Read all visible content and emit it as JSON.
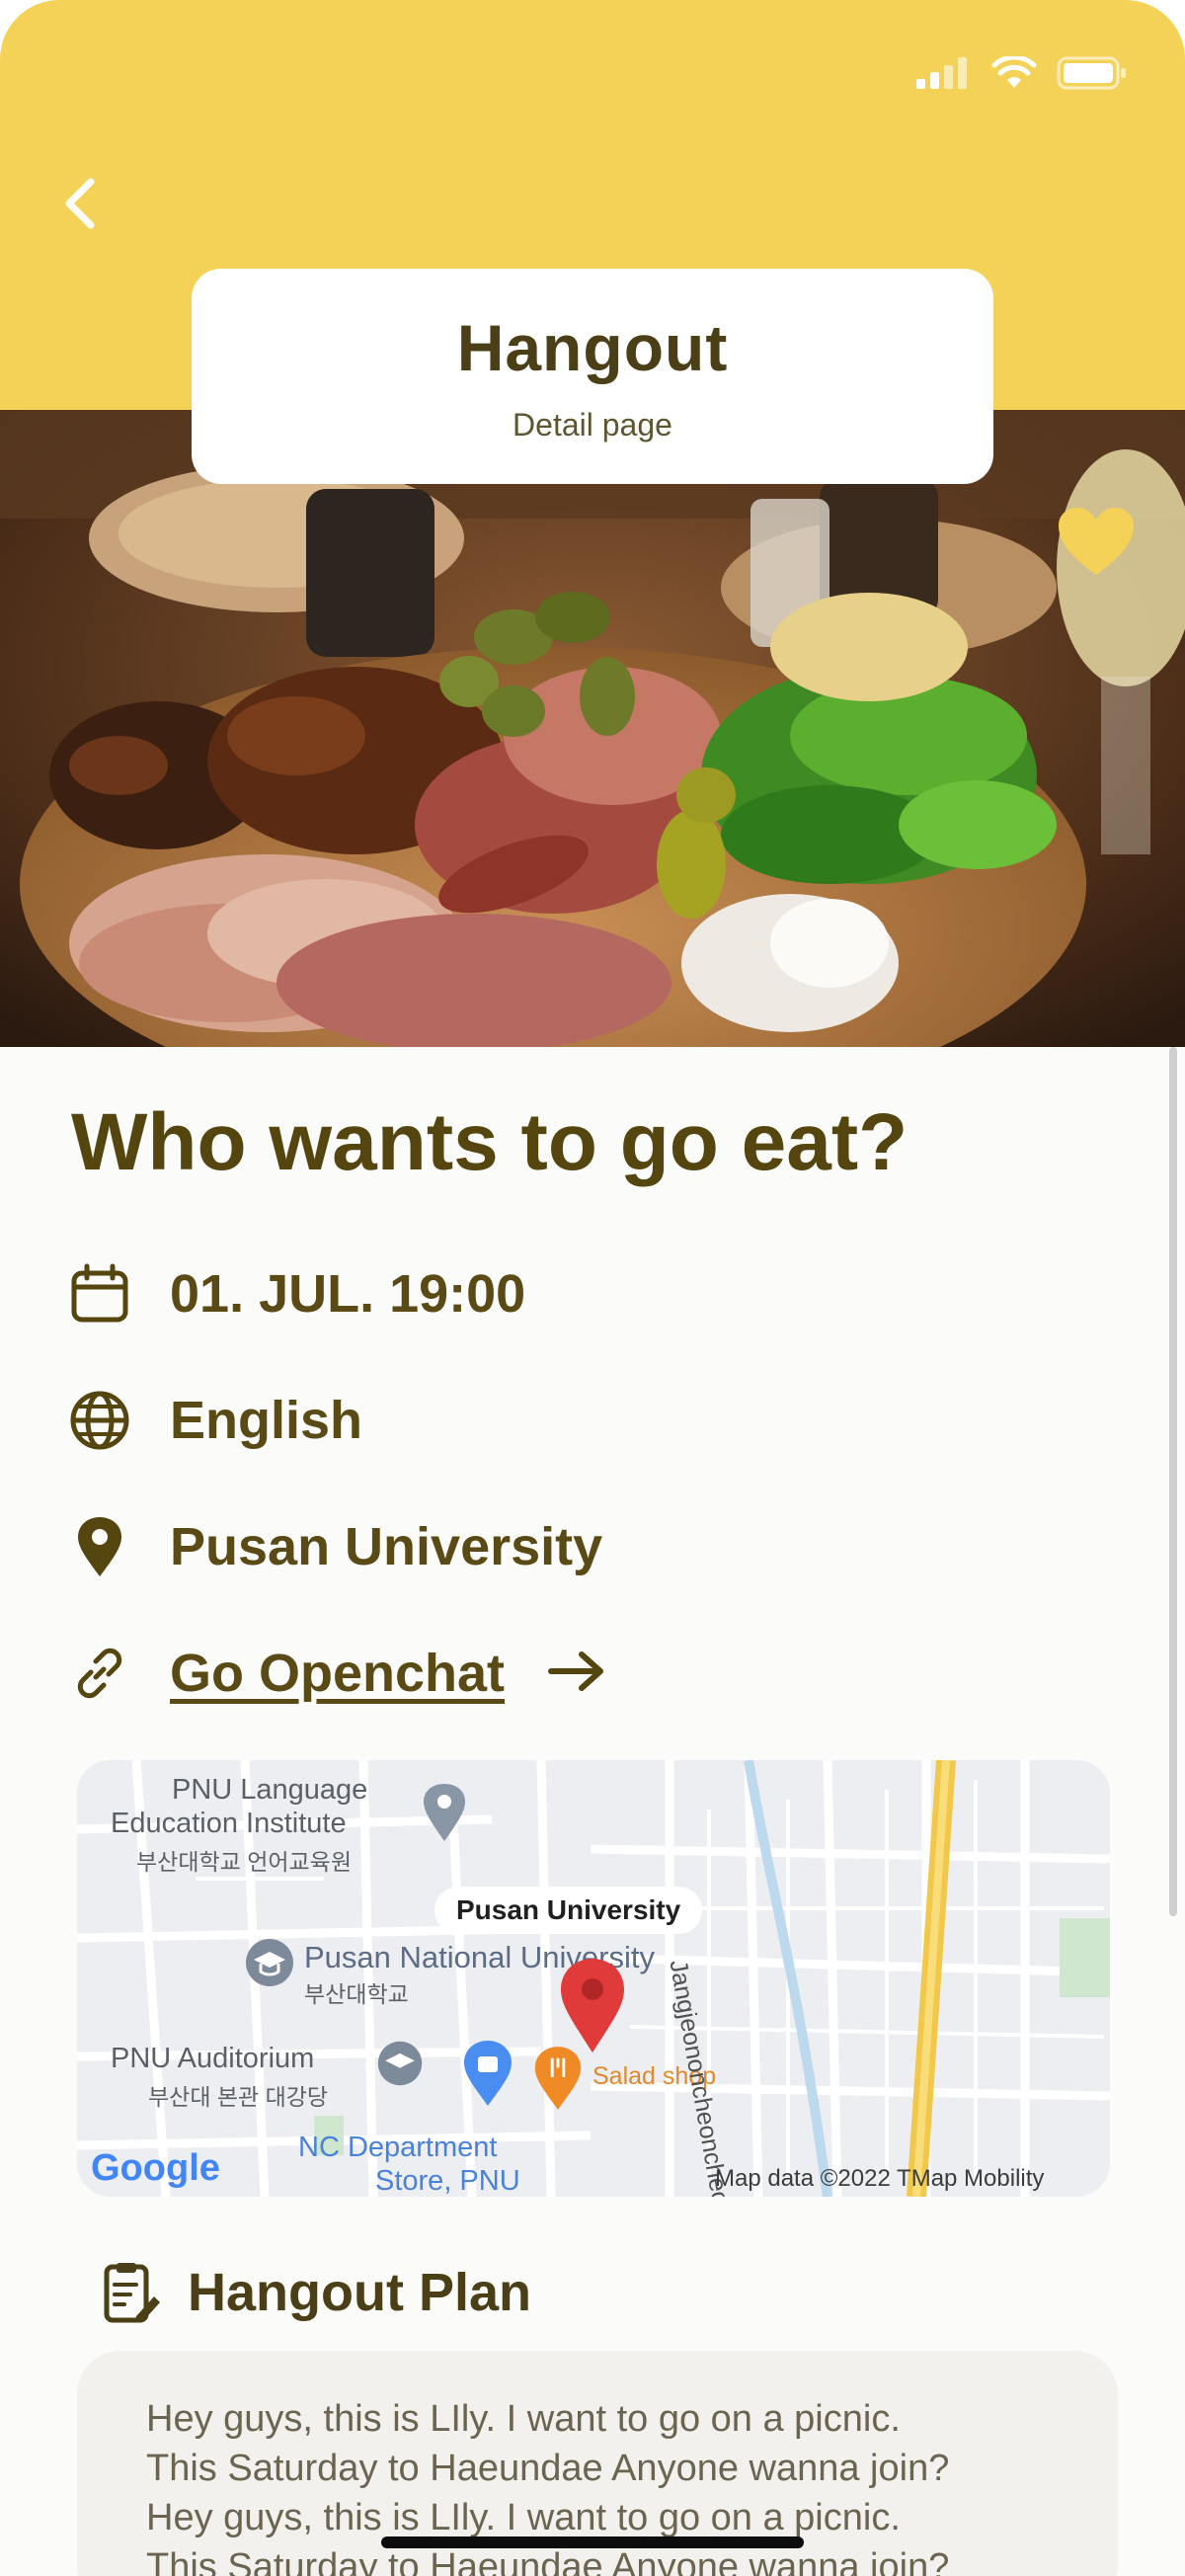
{
  "header": {
    "title": "Hangout",
    "subtitle": "Detail page",
    "bg_color": "#f4d257"
  },
  "status_bar": {
    "icons": [
      "signal-icon",
      "wifi-icon",
      "battery-icon"
    ]
  },
  "post": {
    "title": "Who wants to go eat?",
    "datetime": "01. JUL. 19:00",
    "language": "English",
    "location": "Pusan University",
    "chat_link": "Go Openchat"
  },
  "map": {
    "pin_label": "Pusan University",
    "labels": {
      "pnu_lang_1": "PNU Language",
      "pnu_lang_2": "Education Institute",
      "pnu_lang_ko": "부산대학교 언어교육원",
      "pnu_national": "Pusan National University",
      "pnu_national_ko": "부산대학교",
      "auditorium": "PNU Auditorium",
      "auditorium_ko": "부산대 본관 대강당",
      "salad": "Salad shop",
      "nc_1": "NC Department",
      "nc_2": "Store, PNU",
      "road": "Jangjeononcheon",
      "road2": "cheon",
      "credit": "Map data ©2022 TMap Mobility",
      "google": "Google"
    }
  },
  "plan": {
    "heading": "Hangout Plan",
    "text": "Hey guys, this is LIly. I want to go on a picnic.\nThis Saturday to Haeundae Anyone wanna join?\nHey guys, this is LIly. I want to go on a picnic.\nThis Saturday to Haeundae Anyone wanna join?"
  },
  "colors": {
    "accent": "#f4d257",
    "text_brown": "#55460f",
    "heart": "#f4d257"
  }
}
